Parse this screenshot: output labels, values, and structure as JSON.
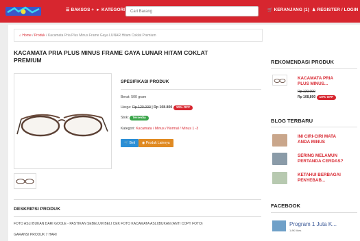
{
  "nav": {
    "baksos": "BAKSOS +",
    "kategori": "KATEGORI +",
    "search_placeholder": "Cari Barang",
    "cart": "KERANJANG (1)",
    "register": "REGISTER / LOGIN",
    "color": "#d7262f"
  },
  "breadcrumb": {
    "home": "Home",
    "sep1": " / ",
    "produk": "Produk",
    "sep2": " / ",
    "current": "Kacamata Pria Plus Minus Frame Gaya LUNAR Hitam Coklat Premium"
  },
  "product": {
    "title_line1": "KACAMATA PRIA PLUS MINUS FRAME GAYA LUNAR HITAM COKLAT",
    "title_line2": "PREMIUM",
    "spec_heading": "SPESIFIKASI PRODUK",
    "berat": "Berat: 500 gram",
    "harga_label": "Harga: ",
    "harga_old": "Rp 120.000",
    "harga_new": " | Rp 108.800",
    "discount": "10% OFF",
    "stok_label": "Stok: ",
    "stok_value": "Tersedia",
    "kategori_label": "Kategori: ",
    "kategori_value": "Kacamata / Minus / Normal / Minus 1 -3",
    "beli_label": "Beli",
    "lainnya_label": "Produk Lainnya"
  },
  "description": {
    "heading": "DESKRIPSI PRODUK",
    "line1": "FOTO ASLI BUKAN DARI GOOLE - PASTIKAN SEBELUM BELI CEK FOTO KACAMATA ASLI(BUKAN (ANTI COPY FOTO)",
    "line2": "GARANSI PRODUK 7 HARI"
  },
  "sidebar": {
    "rekomendasi_heading": "REKOMENDASI PRODUK",
    "rec_title_1": "KACAMATA PRIA",
    "rec_title_2": "PLUS MINUS...",
    "rec_old": "Rp 120.000",
    "rec_new": "Rp 108,800",
    "rec_discount": "10% OFF",
    "blog_heading": "BLOG TERBARU",
    "blogs": [
      {
        "l1": "INI CIRI-CIRI MATA",
        "l2": "ANDA MINUS"
      },
      {
        "l1": "SERING MELAMUN",
        "l2": "PERTANDA CERDAS?"
      },
      {
        "l1": "KETAHUI BERBAGAI",
        "l2": "PENYEBAB..."
      }
    ],
    "facebook_heading": "FACEBOOK",
    "fb_page": "Program 1 Juta K...",
    "fb_likes": "1.8K likes"
  }
}
